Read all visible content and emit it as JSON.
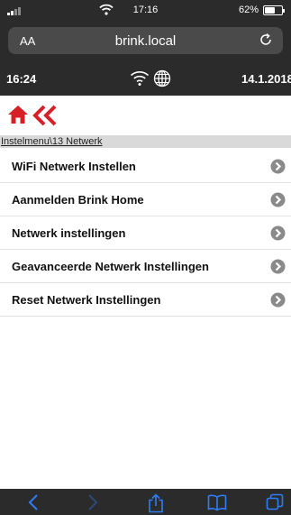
{
  "status_bar": {
    "time": "17:16",
    "battery_percent": "62%",
    "battery_level": 0.62
  },
  "browser": {
    "text_size_label": "AA",
    "url": "brink.local"
  },
  "app_header": {
    "time": "16:24",
    "date": "14.1.2018"
  },
  "breadcrumb": "Instelmenu\\13 Netwerk",
  "menu": {
    "items": [
      {
        "label": "WiFi Netwerk Instellen"
      },
      {
        "label": "Aanmelden Brink Home"
      },
      {
        "label": "Netwerk instellingen"
      },
      {
        "label": "Geavanceerde Netwerk Instellingen"
      },
      {
        "label": "Reset Netwerk Instellingen"
      }
    ]
  },
  "colors": {
    "accent_red": "#d61f26",
    "bar_dark": "#2b2b2b",
    "toolbar_blue": "#2f7cf6",
    "breadcrumb_bg": "#d9d9d9",
    "chevron_grey": "#8a8a8a"
  },
  "icons": [
    "signal-icon",
    "wifi-icon",
    "reload-icon",
    "globe-icon",
    "home-icon",
    "double-back-icon",
    "chevron-right-icon",
    "back-arrow-icon",
    "forward-arrow-icon",
    "share-icon",
    "bookmarks-icon",
    "tabs-icon"
  ]
}
